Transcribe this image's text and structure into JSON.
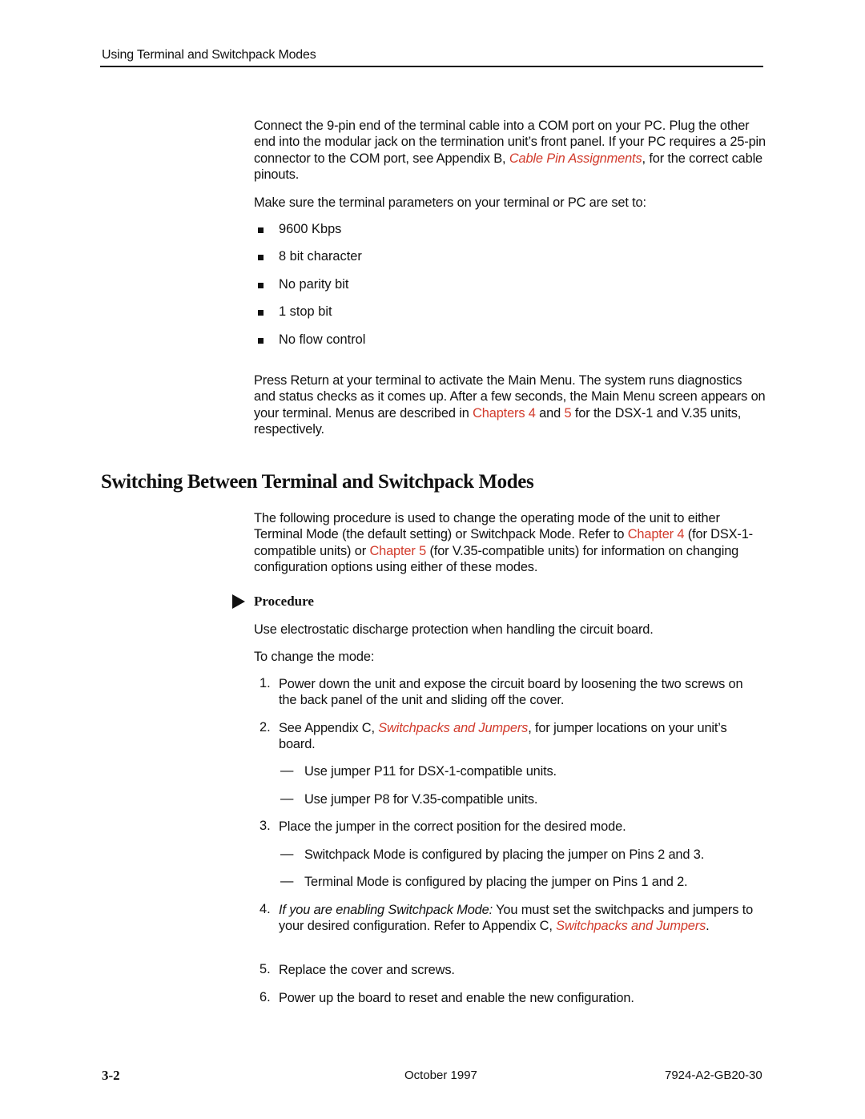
{
  "header": {
    "running_title": "Using Terminal and Switchpack Modes"
  },
  "intro": {
    "p1_a": "Connect the 9-pin end of the terminal cable into a COM port on your PC. Plug the other end into the modular jack on the termination unit’s front panel. If your PC requires a 25-pin connector to the COM port, see Appendix B, ",
    "p1_link": "Cable Pin Assignments",
    "p1_b": ", for the correct cable pinouts.",
    "p2": "Make sure the terminal parameters on your terminal or PC are set to:",
    "settings": [
      "9600 Kbps",
      "8 bit character",
      "No parity bit",
      "1 stop bit",
      "No flow control"
    ],
    "p3_a": "Press Return at your terminal to activate the Main Menu. The system runs diagnostics and status checks as it comes up. After a few seconds, the Main Menu screen appears on your terminal. Menus are described in ",
    "p3_link1": "Chapters 4",
    "p3_mid": " and ",
    "p3_link2": "5",
    "p3_b": " for the DSX-1 and V.35 units, respectively."
  },
  "section": {
    "title": "Switching Between Terminal and Switchpack Modes",
    "p1_a": "The following procedure is used to change the operating mode of the unit to either Terminal Mode (the default setting) or Switchpack Mode. Refer to ",
    "p1_link1": "Chapter 4",
    "p1_mid": " (for DSX-1-compatible units) or ",
    "p1_link2": "Chapter 5",
    "p1_b": " (for V.35-compatible units) for information on changing configuration options using either of these modes.",
    "procedure_label": "Procedure",
    "esd_note": "Use electrostatic discharge protection when handling the circuit board.",
    "lead_in": "To change the mode:",
    "steps": {
      "s1_num": "1.",
      "s1": "Power down the unit and expose the circuit board by loosening the two screws on the back panel of the unit and sliding off the cover.",
      "s2_num": "2.",
      "s2_a": "See Appendix C, ",
      "s2_link": "Switchpacks and Jumpers",
      "s2_b": ", for jumper locations on your unit’s board.",
      "s2_sub": [
        "Use jumper P11 for DSX-1-compatible units.",
        "Use jumper P8 for V.35-compatible units."
      ],
      "s3_num": "3.",
      "s3": "Place the jumper in the correct position for the desired mode.",
      "s3_sub": [
        "Switchpack Mode is configured by placing the jumper on Pins 2 and 3.",
        "Terminal Mode is configured by placing the jumper on Pins 1 and 2."
      ],
      "s4_num": "4.",
      "s4_italic": "If you are enabling Switchpack Mode:",
      "s4_a": " You must set the switchpacks and jumpers to your desired configuration. Refer to Appendix C, ",
      "s4_link": "Switchpacks and Jumpers",
      "s4_b": ".",
      "s5_num": "5.",
      "s5": "Replace the cover and screws.",
      "s6_num": "6.",
      "s6": "Power up the board to reset and enable the new configuration."
    },
    "dash_glyph": "—"
  },
  "footer": {
    "page": "3-2",
    "date": "October 1997",
    "doc_number": "7924-A2-GB20-30"
  }
}
